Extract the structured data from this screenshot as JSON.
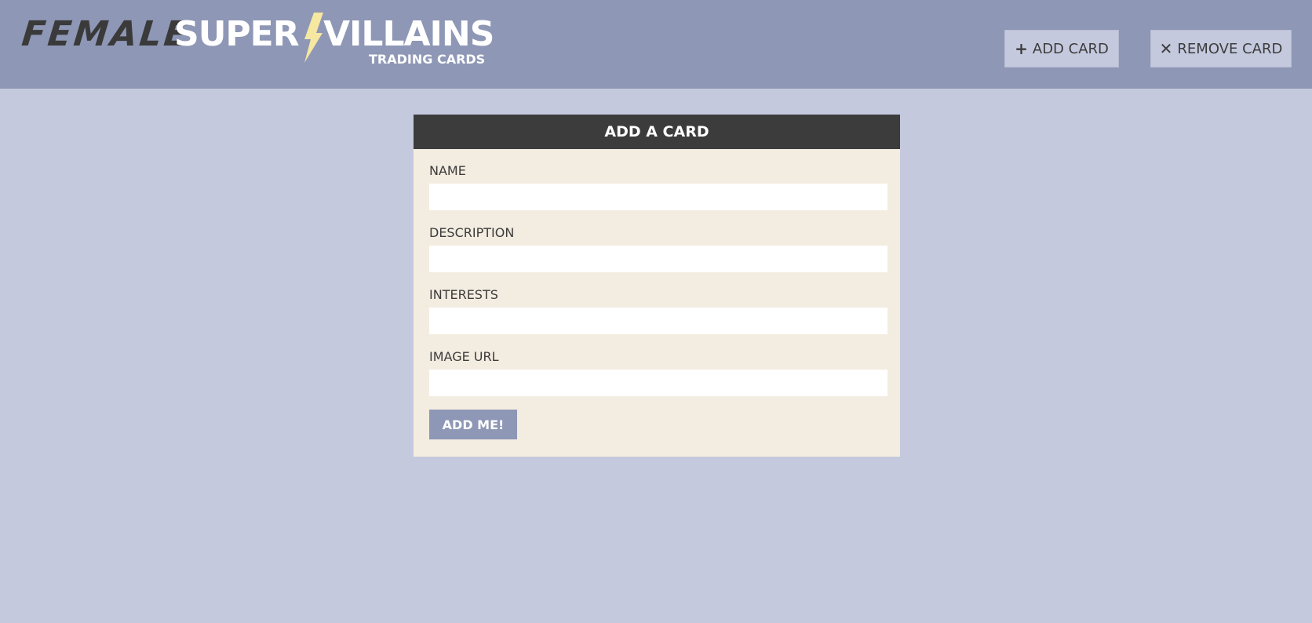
{
  "brand": {
    "word1": "FEMALE",
    "word2": "SUPER",
    "word3": "VILLAINS",
    "tagline": "TRADING CARDS",
    "bolt_color": "#f6e7a1"
  },
  "nav": {
    "add": {
      "icon": "plus-icon",
      "glyph": "+",
      "label": "ADD CARD"
    },
    "remove": {
      "icon": "x-icon",
      "glyph": "✕",
      "label": "REMOVE CARD"
    }
  },
  "form": {
    "title": "ADD A CARD",
    "fields": [
      {
        "label": "NAME",
        "value": "",
        "placeholder": ""
      },
      {
        "label": "DESCRIPTION",
        "value": "",
        "placeholder": ""
      },
      {
        "label": "INTERESTS",
        "value": "",
        "placeholder": ""
      },
      {
        "label": "IMAGE URL",
        "value": "",
        "placeholder": ""
      }
    ],
    "submit_label": "ADD ME!"
  },
  "colors": {
    "header_bg": "#8e97b5",
    "page_bg": "#c5c9de",
    "card_bg": "#f3ece0",
    "card_head_bg": "#3c3c3c",
    "accent": "#8e97b5"
  }
}
